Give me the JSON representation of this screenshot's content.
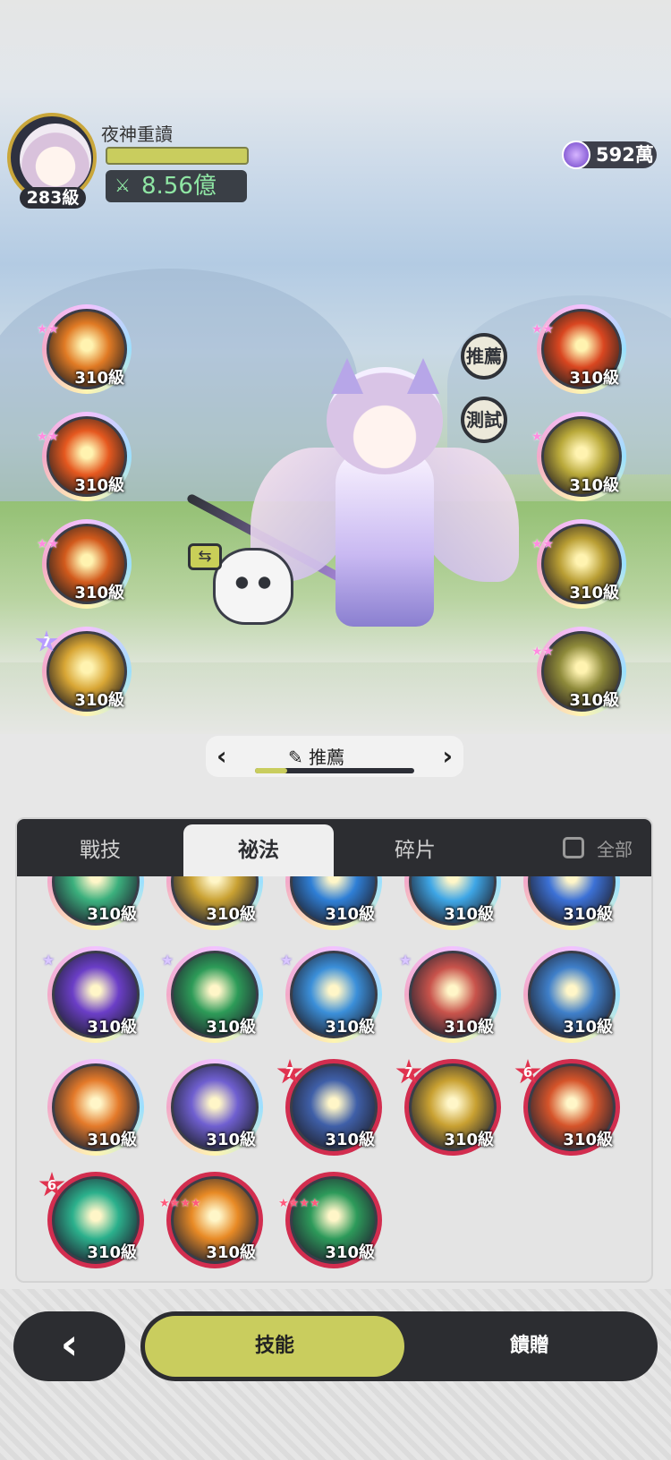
{
  "player": {
    "name": "夜神重讀",
    "level": "283級",
    "power": "8.56億",
    "currency": "592萬"
  },
  "side_buttons": {
    "recommend": "推薦",
    "test": "測試"
  },
  "left_skills": [
    {
      "level": "310級",
      "stars": "★★",
      "color": "#e07a24"
    },
    {
      "level": "310級",
      "stars": "★★",
      "color": "#e5581f"
    },
    {
      "level": "310級",
      "stars": "★★",
      "color": "#d25a1c"
    },
    {
      "level": "310級",
      "star_count": "7",
      "color": "#d8a635"
    }
  ],
  "right_skills": [
    {
      "level": "310級",
      "stars": "★★",
      "color": "#d94620"
    },
    {
      "level": "310級",
      "stars": "★",
      "color": "#b9a93a"
    },
    {
      "level": "310級",
      "stars": "★★",
      "color": "#b99e34"
    },
    {
      "level": "310級",
      "stars": "★★",
      "color": "#8e8a3a"
    }
  ],
  "preset": {
    "label": "推薦",
    "progress": 0.2
  },
  "tabs": {
    "combat": "戰技",
    "secret": "祕法",
    "fragments": "碎片",
    "all": "全部"
  },
  "grid": [
    {
      "level": "310級",
      "frame": "rainbow",
      "star": "★",
      "color": "#3bb07d"
    },
    {
      "level": "310級",
      "frame": "rainbow",
      "star": "★",
      "color": "#c9a132"
    },
    {
      "level": "310級",
      "frame": "rainbow",
      "star": "★",
      "color": "#2f7fd6"
    },
    {
      "level": "310級",
      "frame": "rainbow",
      "star": "★",
      "color": "#3ea6e6"
    },
    {
      "level": "310級",
      "frame": "rainbow",
      "star": "★",
      "color": "#3c71d6"
    },
    {
      "level": "310級",
      "frame": "rainbow",
      "star": "★",
      "color": "#6b3ec7"
    },
    {
      "level": "310級",
      "frame": "rainbow",
      "star": "★",
      "color": "#2d9b58"
    },
    {
      "level": "310級",
      "frame": "rainbow",
      "star": "★",
      "color": "#3b8fd9"
    },
    {
      "level": "310級",
      "frame": "rainbow",
      "star": "★",
      "color": "#c8534b"
    },
    {
      "level": "310級",
      "frame": "rainbow",
      "star": "",
      "color": "#3f7fc9"
    },
    {
      "level": "310級",
      "frame": "rainbow",
      "star": "",
      "color": "#e47a2a"
    },
    {
      "level": "310級",
      "frame": "rainbow",
      "star": "",
      "color": "#6f5fd0"
    },
    {
      "level": "310級",
      "frame": "red",
      "badge": "7",
      "color": "#3f5fa8"
    },
    {
      "level": "310級",
      "frame": "red",
      "badge": "7",
      "color": "#c8a031"
    },
    {
      "level": "310級",
      "frame": "red",
      "badge": "6",
      "color": "#d5542a"
    },
    {
      "level": "310級",
      "frame": "red",
      "badge": "6",
      "color": "#2bb08c"
    },
    {
      "level": "310級",
      "frame": "red",
      "stars": "★★★★",
      "color": "#e88a25"
    },
    {
      "level": "310級",
      "frame": "red",
      "stars": "★★★★",
      "color": "#2d9a5a"
    }
  ],
  "bottom": {
    "skills": "技能",
    "gift": "饋贈",
    "back_icon": "chevron-left-icon"
  }
}
